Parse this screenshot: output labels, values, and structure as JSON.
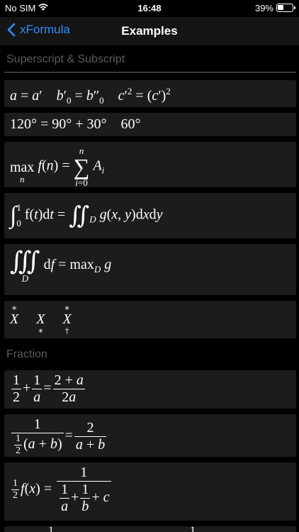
{
  "status_bar": {
    "carrier": "No SIM",
    "time": "16:48",
    "battery": "39%"
  },
  "nav": {
    "back_label": "xFormula",
    "title": "Examples"
  },
  "sections": {
    "superscript": "Superscript & Subscript",
    "fraction": "Fraction"
  },
  "icons": {
    "back": "chevron-left-icon",
    "wifi": "wifi-icon",
    "battery": "battery-icon"
  },
  "colors": {
    "accent": "#2f8cff",
    "card": "#1c1c1e",
    "section_header": "#5b5b5b"
  },
  "formulas": {
    "f1": "a = a′  b′₀ = b″₀  c′² = (c′)²",
    "f2": "120° = 90° + 30°   60°",
    "f3": "max_n f(n) = Σ_{i=0}^{n} A_i",
    "f4": "∫₀¹ f(t)dt = ∬_D g(x, y)dxdy",
    "f5": "∭_D df = max_D g",
    "f6": "X* X* X*†",
    "f7": "1/2 + 1/a = (2 + a)/(2a)",
    "f8": "1/(½(a + b)) = 2/(a + b)",
    "f9": "½ f(x) = 1/(1/a + 1/b + c)"
  }
}
